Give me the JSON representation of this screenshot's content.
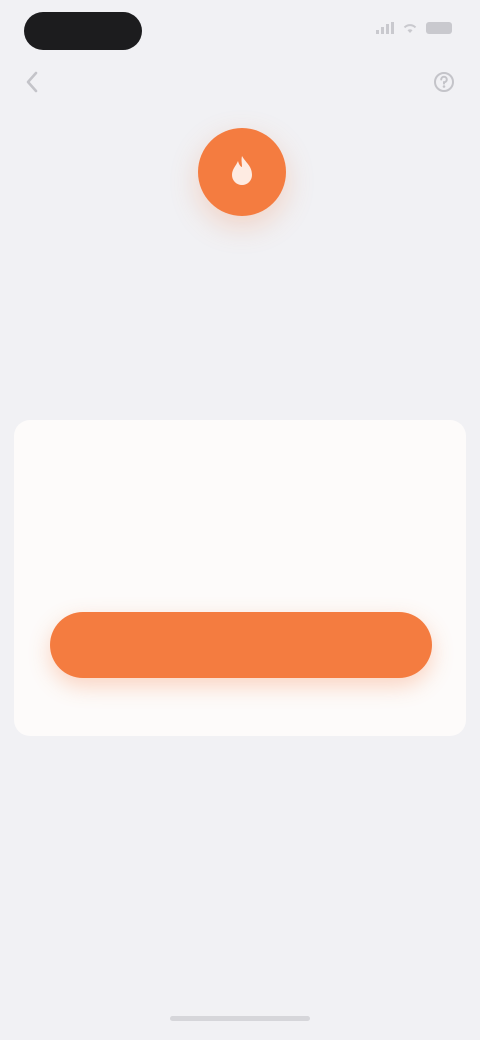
{
  "status_bar": {
    "time": ""
  },
  "icons": {
    "back": "chevron-left-icon",
    "help": "help-icon",
    "hero": "flame-icon",
    "signal": "signal-icon",
    "wifi": "wifi-icon",
    "battery": "battery-icon"
  },
  "colors": {
    "accent": "#f47c40",
    "background": "#f1f1f4",
    "card": "#fdfbfa",
    "link": "#f2a987"
  },
  "header": {
    "title": "",
    "subtitle": ""
  },
  "card": {
    "label": "",
    "text": "",
    "meta": "",
    "primary_button_label": ""
  },
  "secondary_link_label": "",
  "footer_hint": ""
}
